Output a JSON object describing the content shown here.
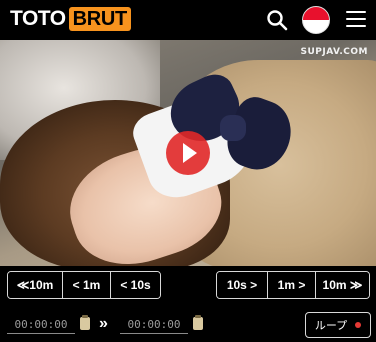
{
  "header": {
    "logo_left": "TOTO",
    "logo_right": "BRUT",
    "logo_accent_color": "#f7931e",
    "icons": [
      "search-icon",
      "japan-flag-icon",
      "menu-icon"
    ]
  },
  "video": {
    "watermark": "SUPJAV.COM",
    "play_button_color": "#e12828"
  },
  "seek": {
    "back": [
      "≪10m",
      "< 1m",
      "< 10s"
    ],
    "forward": [
      "10s >",
      "1m >",
      "10m ≫"
    ]
  },
  "loop": {
    "start_time": "00:00:00",
    "end_time": "00:00:00",
    "loop_label": "ループ",
    "status_color": "#e53935"
  }
}
